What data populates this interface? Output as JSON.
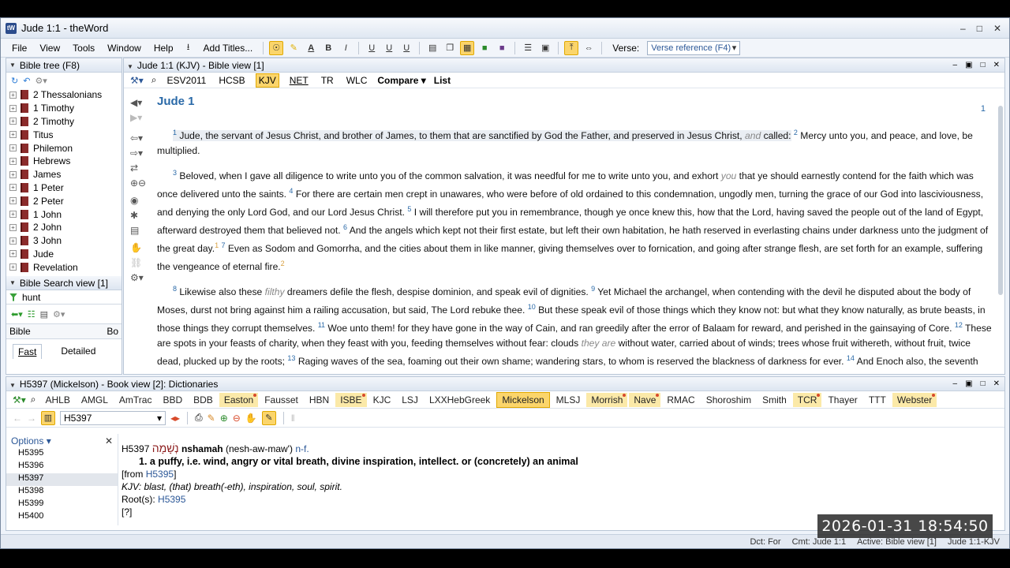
{
  "window": {
    "title": "Jude 1:1 - theWord",
    "app_icon": "tW"
  },
  "menu": [
    "File",
    "View",
    "Tools",
    "Window",
    "Help"
  ],
  "toolbar": {
    "add_titles": "Add Titles...",
    "bold": "B",
    "italic": "I",
    "verse_label": "Verse:",
    "verse_combo": "Verse reference (F4)"
  },
  "bible_tree": {
    "header": "Bible tree (F8)",
    "books": [
      "2 Thessalonians",
      "1 Timothy",
      "2 Timothy",
      "Titus",
      "Philemon",
      "Hebrews",
      "James",
      "1 Peter",
      "2 Peter",
      "1 John",
      "2 John",
      "3 John",
      "Jude",
      "Revelation"
    ]
  },
  "bible_search": {
    "header": "Bible Search view [1]",
    "query": "hunt",
    "col1": "Bible",
    "col2": "Bo",
    "tab_fast": "Fast",
    "tab_detailed": "Detailed"
  },
  "bible_view": {
    "header": "Jude 1:1 (KJV) - Bible view [1]",
    "translations": [
      "ESV2011",
      "HCSB",
      "KJV",
      "NET",
      "TR",
      "WLC"
    ],
    "compare": "Compare",
    "list": "List",
    "chapter": "Jude 1",
    "page": "1",
    "v1n": "1",
    "v1": "Jude, the servant of Jesus Christ, and brother of James, to them that are sanctified by God the Father, and preserved in Jesus Christ,",
    "v1it": "and",
    "v1b": "called:",
    "v2n": "2",
    "v2": "Mercy unto you, and peace, and love, be multiplied.",
    "v3n": "3",
    "v3": "Beloved, when I gave all diligence to write unto you of the common salvation, it was needful for me to write unto you, and exhort",
    "v3it": "you",
    "v3b": "that ye should earnestly contend for the faith which was once delivered unto the saints.",
    "v4n": "4",
    "v4": "For there are certain men crept in unawares, who were before of old ordained to this condemnation, ungodly men, turning the grace of our God into lasciviousness, and denying the only Lord God, and our Lord Jesus Christ.",
    "v5n": "5",
    "v5": "I will therefore put you in remembrance, though ye once knew this, how that the Lord, having saved the people out of the land of Egypt, afterward destroyed them that believed not.",
    "v6n": "6",
    "v6": "And the angels which kept not their first estate, but left their own habitation, he hath reserved in everlasting chains under darkness unto the judgment of the great day.",
    "fn1": "1",
    "v7n": "7",
    "v7": "Even as Sodom and Gomorrha, and the cities about them in like manner, giving themselves over to fornication, and going after strange flesh, are set forth for an example, suffering the vengeance of eternal fire.",
    "fn2": "2",
    "v8n": "8",
    "v8a": "Likewise also these",
    "v8it": "filthy",
    "v8b": "dreamers defile the flesh, despise dominion, and speak evil of dignities.",
    "v9n": "9",
    "v9": "Yet Michael the archangel, when contending with the devil he disputed about the body of Moses, durst not bring against him a railing accusation, but said, The Lord rebuke thee.",
    "v10n": "10",
    "v10": "But these speak evil of those things which they know not: but what they know naturally, as brute beasts, in those things they corrupt themselves.",
    "v11n": "11",
    "v11": "Woe unto them! for they have gone in the way of Cain, and ran greedily after the error of Balaam for reward, and perished in the gainsaying of Core.",
    "v12n": "12",
    "v12a": "These are spots in your feasts of charity, when they feast with you, feeding themselves without fear: clouds",
    "v12it": "they are",
    "v12b": "without water, carried about of winds; trees whose fruit withereth, without fruit, twice dead, plucked up by the roots;",
    "v13n": "13",
    "v13": "Raging waves of the sea, foaming out their own shame; wandering stars, to whom is reserved the blackness of darkness for ever.",
    "v14n": "14",
    "v14": "And Enoch also, the seventh from Adam, prophesied of these, saying, Behold, the Lord cometh with ten thousands of his saints,"
  },
  "book_view": {
    "header": "H5397 (Mickelson) - Book view [2]: Dictionaries",
    "dicts": [
      "AHLB",
      "AMGL",
      "AmTrac",
      "BBD",
      "BDB",
      "Easton",
      "Fausset",
      "HBN",
      "ISBE",
      "KJC",
      "LSJ",
      "LXXHebGreek",
      "Mickelson",
      "MLSJ",
      "Morrish",
      "Nave",
      "RMAC",
      "Shoroshim",
      "Smith",
      "TCR",
      "Thayer",
      "TTT",
      "Webster"
    ],
    "input": "H5397",
    "options_label": "Options",
    "options": [
      "H5395",
      "H5396",
      "H5397",
      "H5398",
      "H5399",
      "H5400"
    ],
    "entry_id": "H5397",
    "entry_heb": "נְשָׁמָה",
    "entry_translit": "nshamah",
    "entry_pron": "(nesh-aw-maw')",
    "entry_pos": "n-f.",
    "entry_def": "1. a puffy, i.e. wind, angry or vital breath, divine inspiration, intellect. or (concretely) an animal",
    "from_label": "[from",
    "from_ref": "H5395",
    "from_close": "]",
    "kjv": "KJV: blast, (that) breath(-eth), inspiration, soul, spirit.",
    "roots_label": "Root(s):",
    "roots_ref": "H5395",
    "note": "[?]"
  },
  "status": {
    "dct": "Dct: For",
    "cmt": "Cmt: Jude 1:1",
    "active": "Active: Bible view [1]",
    "ref": "Jude 1:1-KJV"
  },
  "clock": "2026-01-31  18:54:50"
}
